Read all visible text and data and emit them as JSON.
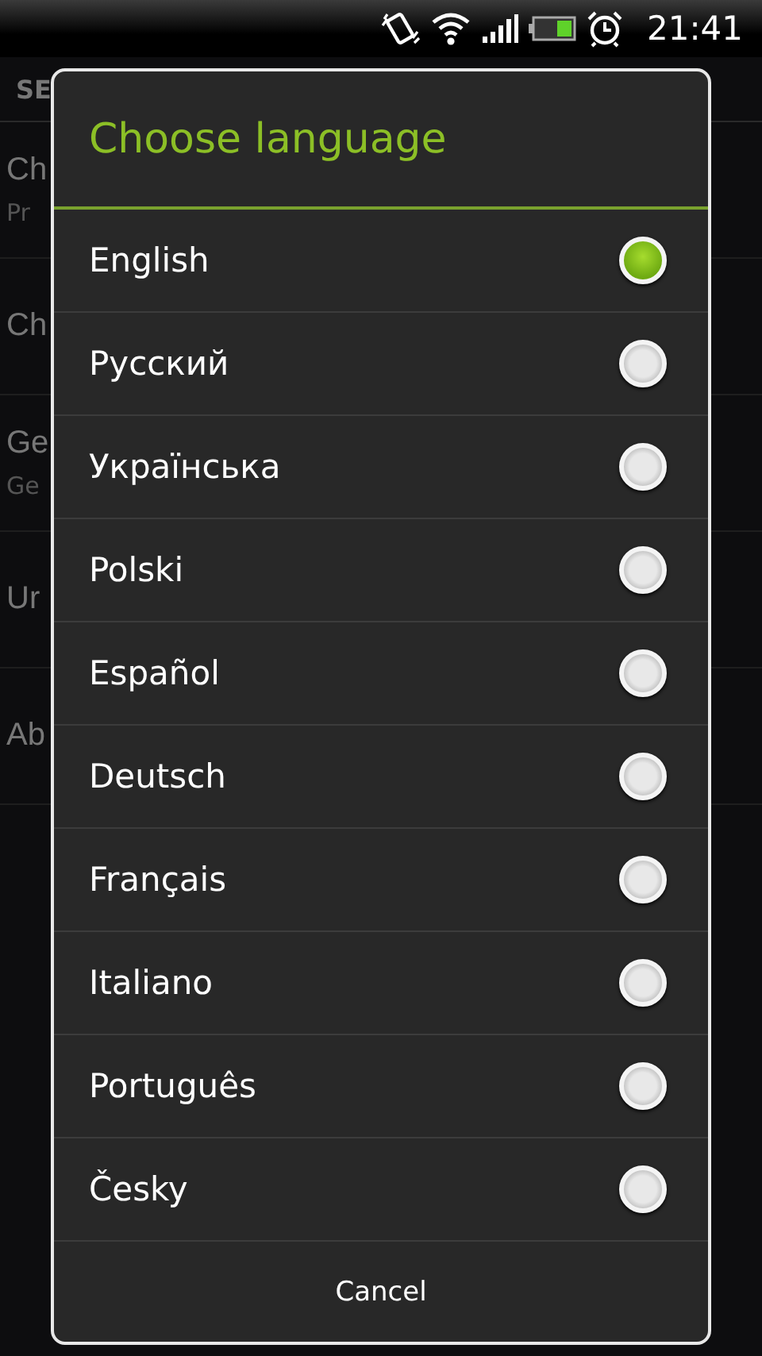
{
  "status_bar": {
    "time": "21:41"
  },
  "background": {
    "header": "SE",
    "items": [
      {
        "title": "Ch",
        "subtitle": "Pr"
      },
      {
        "title": "Ch"
      },
      {
        "title": "Ge",
        "subtitle": "Ge"
      },
      {
        "title": "Ur"
      },
      {
        "title": "Ab"
      }
    ]
  },
  "dialog": {
    "title": "Choose language",
    "options": [
      {
        "label": "English",
        "selected": true
      },
      {
        "label": "Русский",
        "selected": false
      },
      {
        "label": "Українська",
        "selected": false
      },
      {
        "label": "Polski",
        "selected": false
      },
      {
        "label": "Español",
        "selected": false
      },
      {
        "label": "Deutsch",
        "selected": false
      },
      {
        "label": "Français",
        "selected": false
      },
      {
        "label": "Italiano",
        "selected": false
      },
      {
        "label": "Português",
        "selected": false
      },
      {
        "label": "Česky",
        "selected": false
      }
    ],
    "buttons": [
      "Cancel"
    ]
  }
}
